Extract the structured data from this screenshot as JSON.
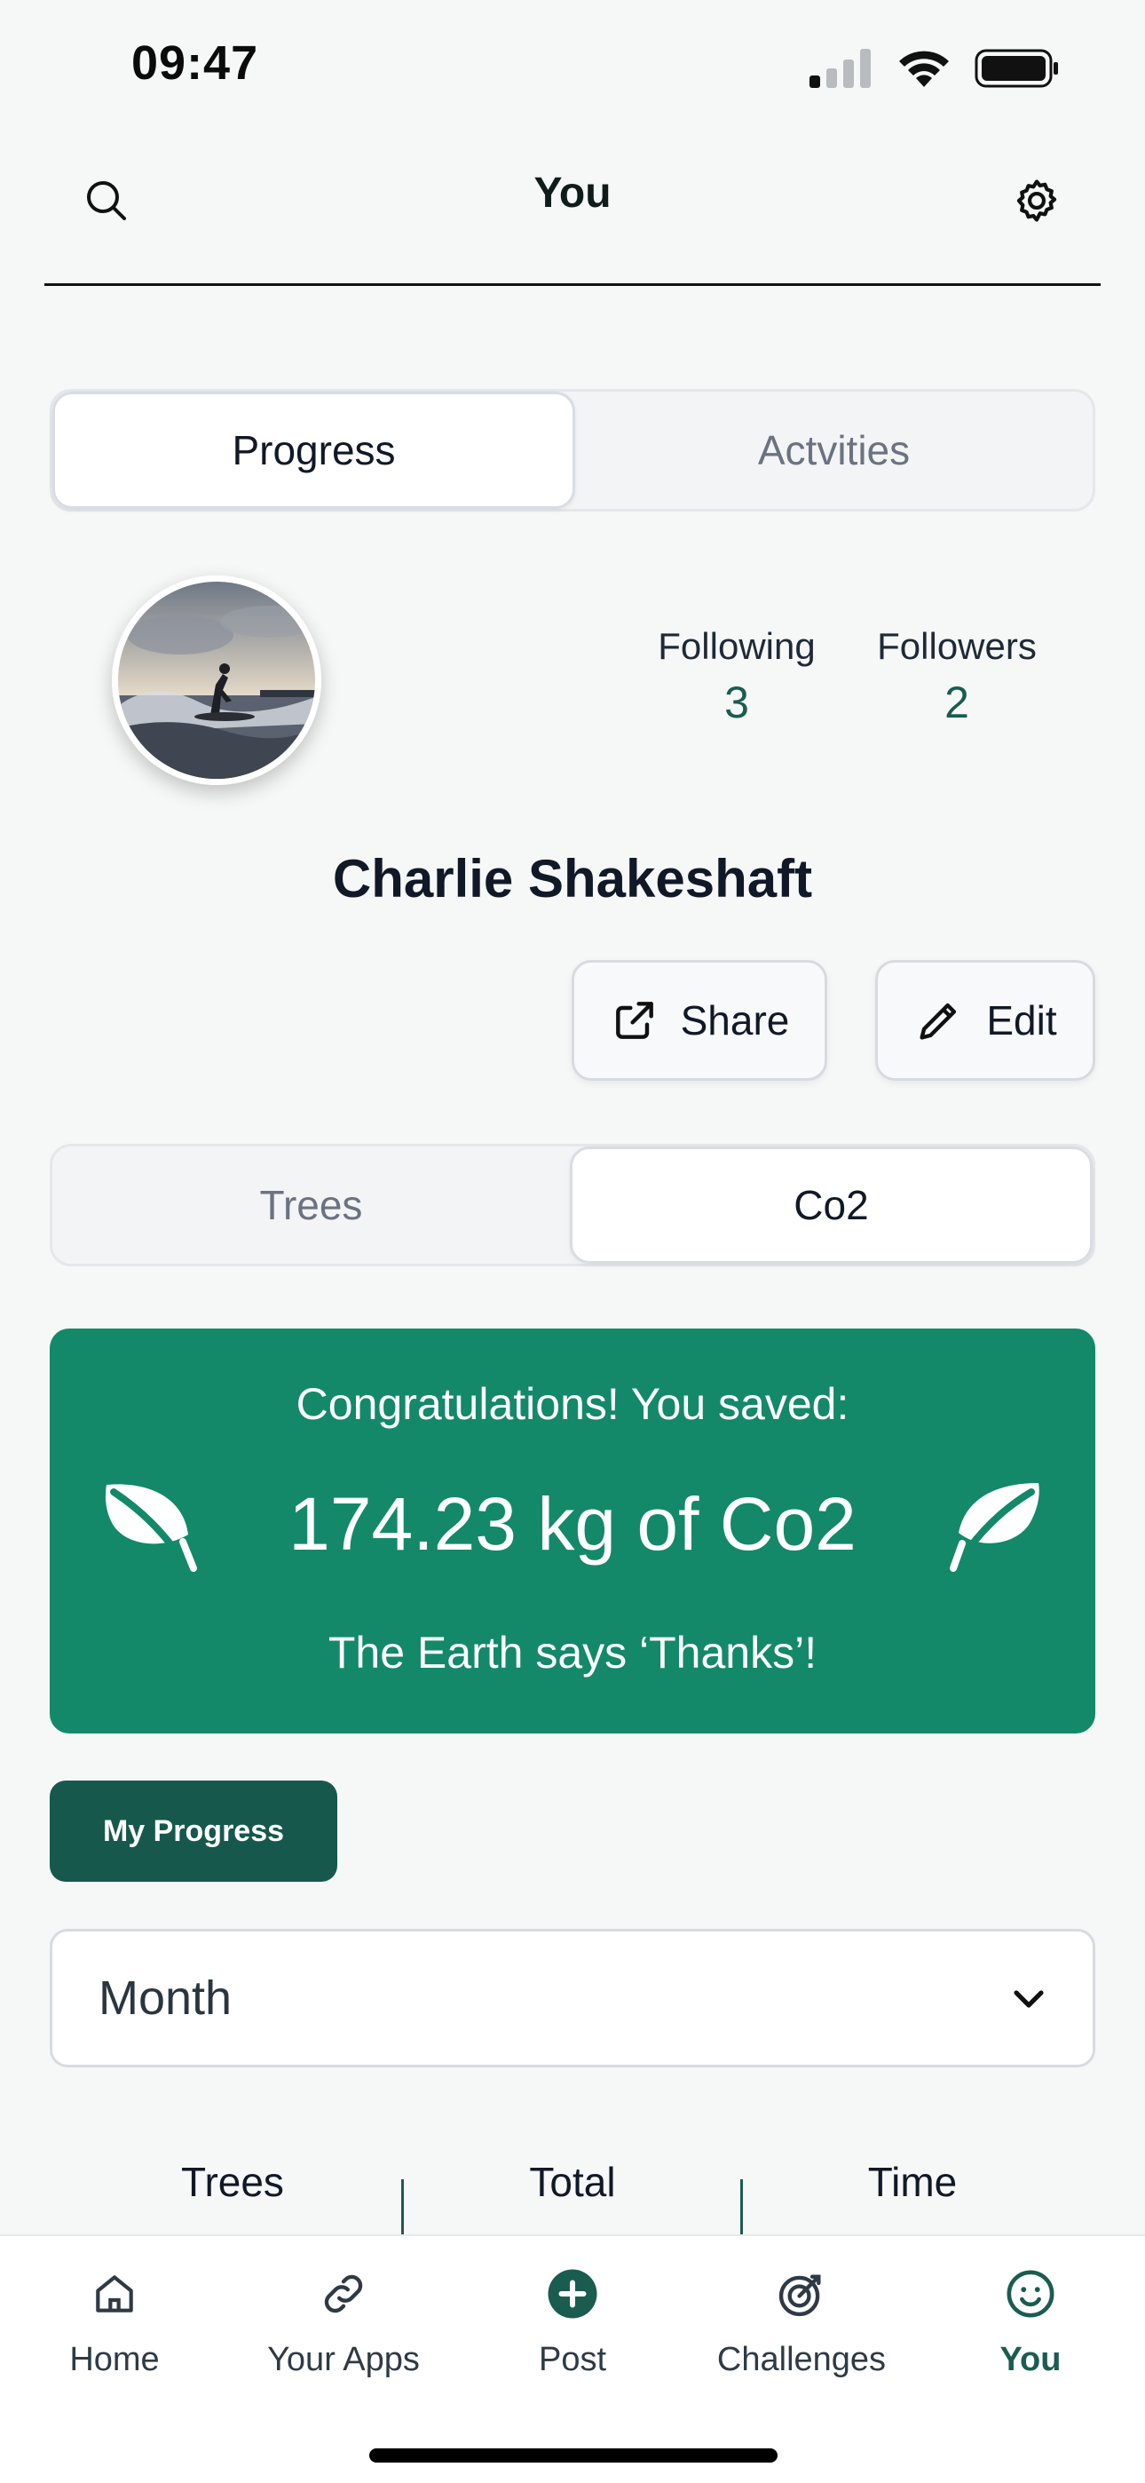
{
  "status_bar": {
    "time": "09:47"
  },
  "header": {
    "title": "You"
  },
  "main_tabs": [
    {
      "label": "Progress",
      "active": true
    },
    {
      "label": "Actvities",
      "active": false
    }
  ],
  "profile": {
    "name": "Charlie Shakeshaft",
    "following_label": "Following",
    "following_count": "3",
    "followers_label": "Followers",
    "followers_count": "2",
    "share_label": "Share",
    "edit_label": "Edit"
  },
  "metric_tabs": [
    {
      "label": "Trees",
      "active": false
    },
    {
      "label": "Co2",
      "active": true
    }
  ],
  "banner": {
    "top": "Congratulations! You saved:",
    "amount": "174.23 kg of Co2",
    "bottom": "The Earth says ‘Thanks’!"
  },
  "progress_button": "My Progress",
  "period_select": {
    "value": "Month"
  },
  "summary": {
    "trees_label": "Trees",
    "trees_value": "",
    "total_label": "Total",
    "total_value": "",
    "time_label": "Time",
    "time_value": ""
  },
  "tabbar": [
    {
      "label": "Home",
      "icon": "home-icon"
    },
    {
      "label": "Your Apps",
      "icon": "link-icon"
    },
    {
      "label": "Post",
      "icon": "plus-circle-icon"
    },
    {
      "label": "Challenges",
      "icon": "target-icon"
    },
    {
      "label": "You",
      "icon": "smile-icon",
      "active": true
    }
  ],
  "colors": {
    "brand": "#13896a",
    "brand_dark": "#17584d",
    "accent_text": "#1a5c50"
  }
}
